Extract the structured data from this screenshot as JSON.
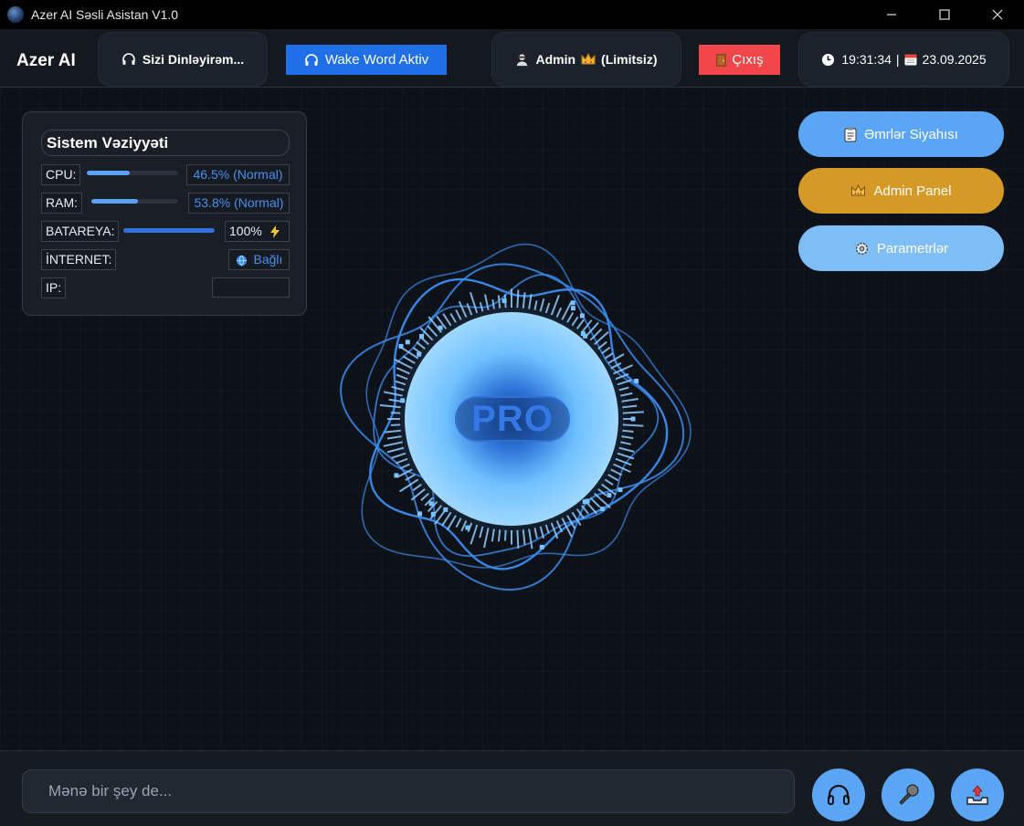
{
  "window": {
    "title": "Azer AI Səsli Asistan V1.0",
    "icon": "app-globe-icon"
  },
  "header": {
    "brand": "Azer AI",
    "listening_status": "Sizi Dinləyirəm...",
    "wake_word_button": "Wake Word Aktiv",
    "user_label": "Admin",
    "user_badge": "(Limitsiz)",
    "logout_button": "Çıxış",
    "time": "19:31:34",
    "separator": "|",
    "date": "23.09.2025",
    "colors": {
      "wake_word_bg": "#1e6fe8",
      "logout_bg": "#f2474a"
    }
  },
  "system_panel": {
    "title": "Sistem Vəziyyəti",
    "cpu": {
      "label": "CPU:",
      "value_text": "46.5% (Normal)",
      "percent": 46.5
    },
    "ram": {
      "label": "RAM:",
      "value_text": "53.8% (Normal)",
      "percent": 53.8
    },
    "battery": {
      "label": "BATAREYA:",
      "value_text": "100%",
      "percent": 100,
      "icon": "lightning-icon"
    },
    "internet": {
      "label": "İNTERNET:",
      "value_text": "Bağlı",
      "icon": "globe-icon"
    },
    "ip": {
      "label": "IP:",
      "value_text": ""
    }
  },
  "side_buttons": {
    "commands": {
      "label": "Əmrlər Siyahısı",
      "icon": "clipboard-icon",
      "color": "#5ba5f5"
    },
    "admin": {
      "label": "Admin Panel",
      "icon": "crown-icon",
      "color": "#d49a25"
    },
    "settings": {
      "label": "Parametrlər",
      "icon": "gear-icon",
      "color": "#7fbdf7"
    }
  },
  "orb": {
    "label": "PRO"
  },
  "bottom": {
    "input_placeholder": "Mənə bir şey de...",
    "buttons": [
      "headphones-icon",
      "microphone-icon",
      "upload-icon"
    ]
  }
}
